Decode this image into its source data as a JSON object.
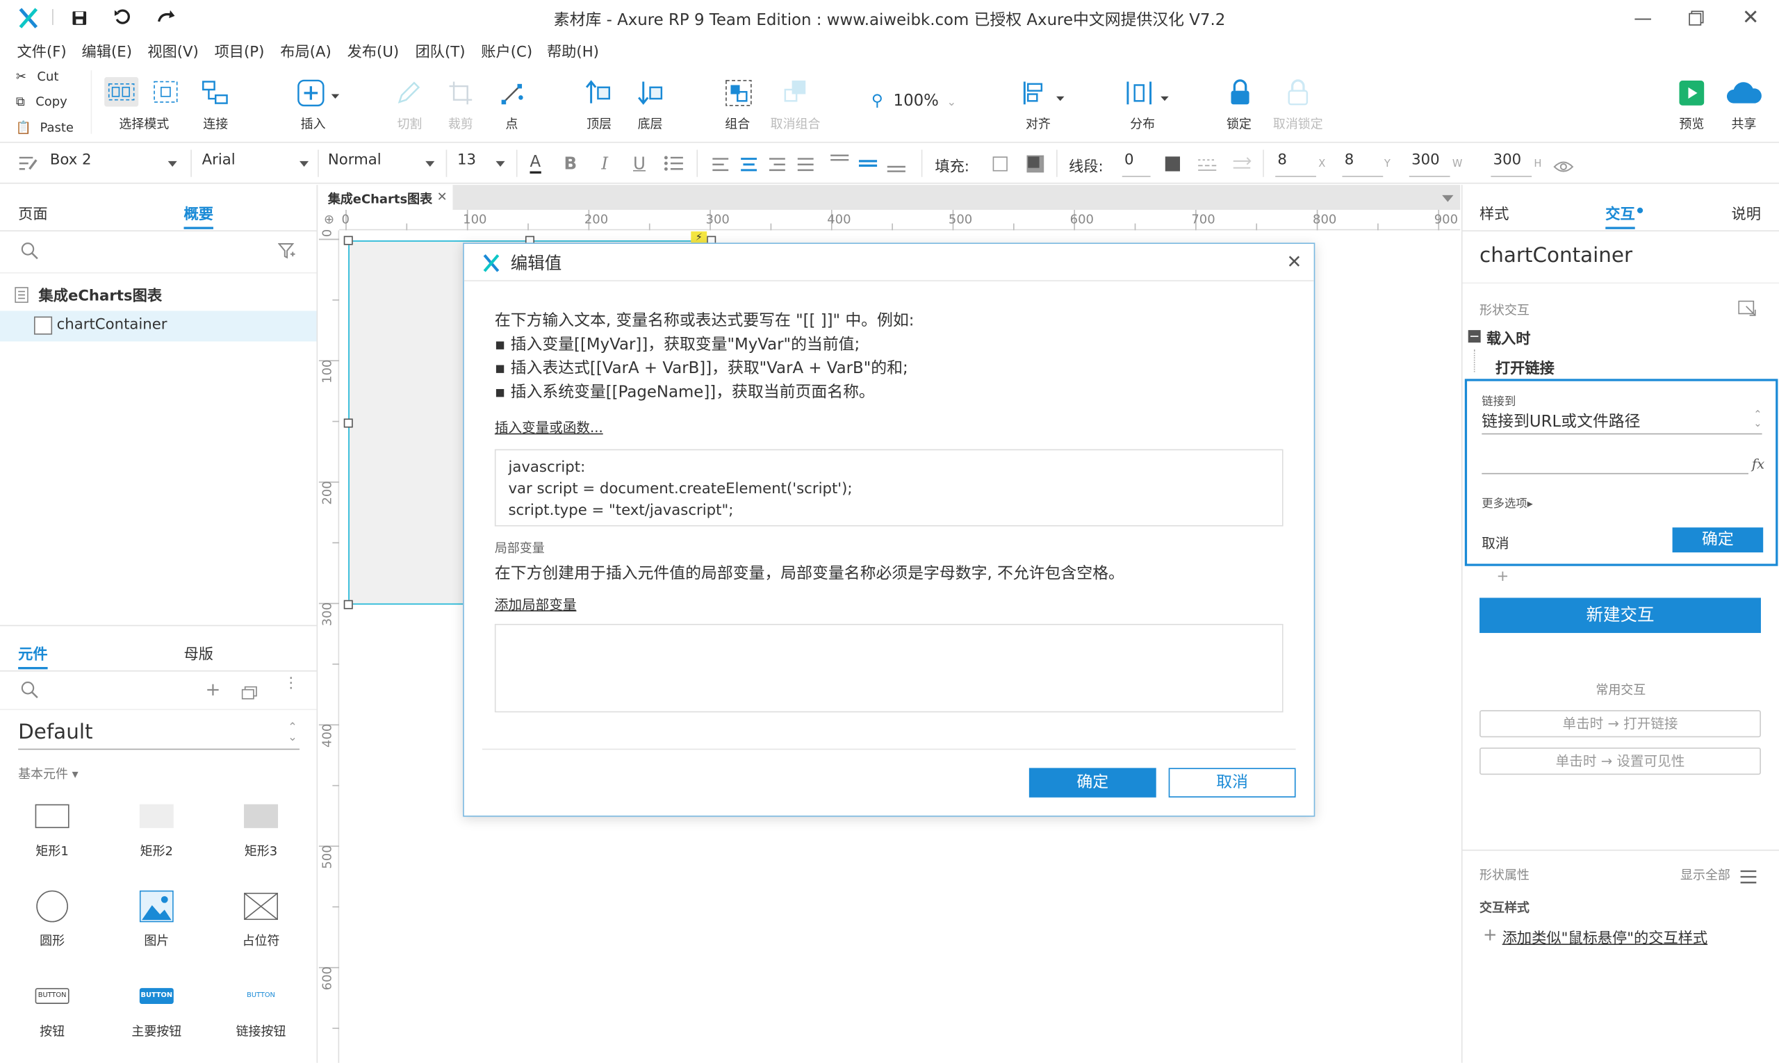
{
  "window": {
    "title": "素材库 - Axure RP 9 Team Edition : www.aiweibk.com 已授权    Axure中文网提供汉化 V7.2"
  },
  "menu": [
    "文件(F)",
    "编辑(E)",
    "视图(V)",
    "项目(P)",
    "布局(A)",
    "发布(U)",
    "团队(T)",
    "账户(C)",
    "帮助(H)"
  ],
  "clipboard": {
    "cut": "Cut",
    "copy": "Copy",
    "paste": "Paste"
  },
  "toolbar": {
    "select_mode": "选择模式",
    "connect": "连接",
    "insert": "插入",
    "cut": "切割",
    "crop": "裁剪",
    "point": "点",
    "top": "顶层",
    "bottom": "底层",
    "group": "组合",
    "ungroup": "取消组合",
    "zoom": "100%",
    "align": "对齐",
    "distribute": "分布",
    "lock": "锁定",
    "unlock": "取消锁定",
    "preview": "预览",
    "share": "共享"
  },
  "formatbar": {
    "element": "Box 2",
    "font": "Arial",
    "style": "Normal",
    "size": "13",
    "fill_label": "填充:",
    "line_label": "线段:",
    "line_value": "0",
    "x": "8",
    "x_label": "X",
    "y": "8",
    "y_label": "Y",
    "w": "300",
    "w_label": "W",
    "h": "300",
    "h_label": "H"
  },
  "leftpanel": {
    "tabs": {
      "pages": "页面",
      "outline": "概要"
    },
    "page_name": "集成eCharts图表",
    "outline_item": "chartContainer",
    "lib_tabs": {
      "widgets": "元件",
      "masters": "母版"
    },
    "library": "Default",
    "basic_label": "基本元件 ▾",
    "widgets": [
      {
        "label": "矩形1",
        "icon": "rect1-icon"
      },
      {
        "label": "矩形2",
        "icon": "rect2-icon"
      },
      {
        "label": "矩形3",
        "icon": "rect3-icon"
      },
      {
        "label": "圆形",
        "icon": "circle-icon"
      },
      {
        "label": "图片",
        "icon": "image-icon"
      },
      {
        "label": "占位符",
        "icon": "placeholder-icon"
      },
      {
        "label": "按钮",
        "icon": "button-icon",
        "text": "BUTTON"
      },
      {
        "label": "主要按钮",
        "icon": "primary-button-icon",
        "text": "BUTTON"
      },
      {
        "label": "链接按钮",
        "icon": "link-button-icon",
        "text": "BUTTON"
      }
    ]
  },
  "canvas": {
    "doc_tab": "集成eCharts图表",
    "ruler_h": [
      "0",
      "100",
      "200",
      "300",
      "400",
      "500",
      "600",
      "700",
      "800",
      "900"
    ],
    "ruler_v": [
      "0",
      "100",
      "200",
      "300",
      "400",
      "500",
      "600"
    ]
  },
  "dialog": {
    "title": "编辑值",
    "intro": "在下方输入文本, 变量名称或表达式要写在 \"[[ ]]\" 中。例如:",
    "bullet1": "▪ 插入变量[[MyVar]]，获取变量\"MyVar\"的当前值;",
    "bullet2": "▪ 插入表达式[[VarA + VarB]]，获取\"VarA + VarB\"的和;",
    "bullet3": "▪ 插入系统变量[[PageName]]，获取当前页面名称。",
    "insert_link": "插入变量或函数...",
    "code_line1": "javascript:",
    "code_line2": "var script = document.createElement('script');",
    "code_line3": "script.type = \"text/javascript\";",
    "local_vars_label": "局部变量",
    "local_vars_desc": "在下方创建用于插入元件值的局部变量，局部变量名称必须是字母数字, 不允许包含空格。",
    "add_local_var": "添加局部变量",
    "ok": "确定",
    "cancel": "取消"
  },
  "rightpanel": {
    "tabs": {
      "style": "样式",
      "interact": "交互",
      "notes": "说明"
    },
    "element_name": "chartContainer",
    "shape_interact": "形状交互",
    "on_load": "载入时",
    "open_link": "打开链接",
    "link_to_label": "链接到",
    "link_to_value": "链接到URL或文件路径",
    "more_options": "更多选项▸",
    "cancel": "取消",
    "ok": "确定",
    "plus": "+",
    "new_interaction": "新建交互",
    "common_label": "常用交互",
    "common1": "单击时 → 打开链接",
    "common2": "单击时 → 设置可见性",
    "shape_props": "形状属性",
    "show_all": "显示全部",
    "interact_style": "交互样式",
    "add_hover": "添加类似\"鼠标悬停\"的交互样式"
  },
  "colors": {
    "accent": "#1a8ad6",
    "selection": "#17b5d6"
  }
}
